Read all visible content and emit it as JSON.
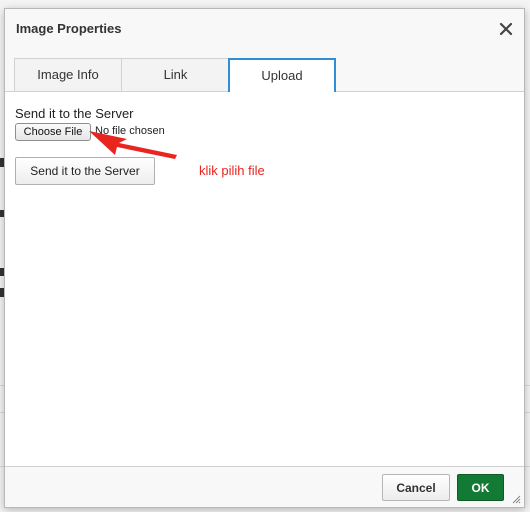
{
  "dialog": {
    "title": "Image Properties",
    "close_icon": "close-icon"
  },
  "tabs": [
    {
      "label": "Image Info",
      "active": false
    },
    {
      "label": "Link",
      "active": false
    },
    {
      "label": "Upload",
      "active": true
    }
  ],
  "upload": {
    "field_label": "Send it to the Server",
    "choose_file_label": "Choose File",
    "file_status": "No file chosen",
    "send_button_label": "Send it to the Server"
  },
  "annotation": {
    "text": "klik pilih file",
    "color": "#e8251f",
    "icon": "arrow-pointer-icon"
  },
  "footer": {
    "cancel_label": "Cancel",
    "ok_label": "OK"
  },
  "colors": {
    "accent_tab_border": "#2f8ed6",
    "ok_button": "#137a35"
  }
}
